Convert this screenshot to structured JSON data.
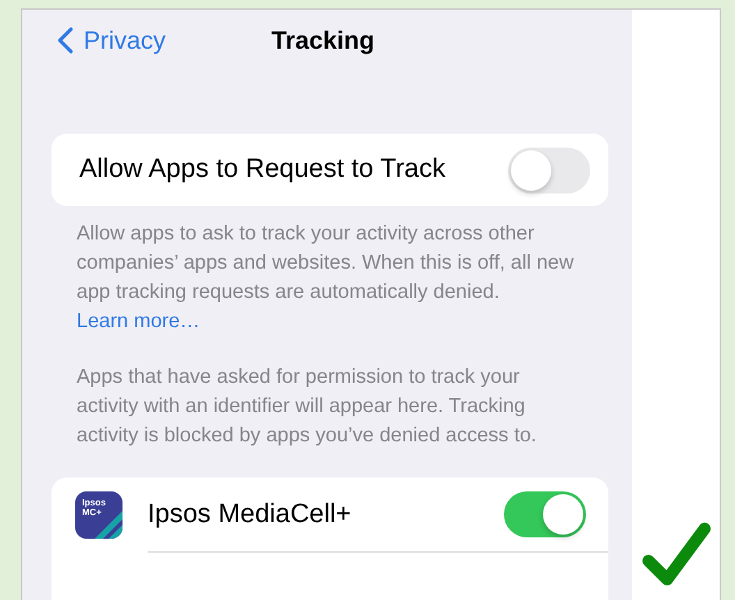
{
  "nav": {
    "back_label": "Privacy",
    "title": "Tracking"
  },
  "allow_setting": {
    "label": "Allow Apps to Request to Track",
    "on": false
  },
  "allow_footer": {
    "text": "Allow apps to ask to track your activity across other companies’ apps and websites. When this is off, all new app tracking requests are automatically denied. ",
    "link": "Learn more…"
  },
  "apps_note": "Apps that have asked for permission to track your activity with an identifier will appear here. Tracking activity is blocked by apps you’ve denied access to.",
  "apps": [
    {
      "name": "Ipsos MediaCell+",
      "icon_lines": [
        "Ipsos",
        "MC+"
      ],
      "on": true
    }
  ],
  "verdict": {
    "correct": true
  }
}
